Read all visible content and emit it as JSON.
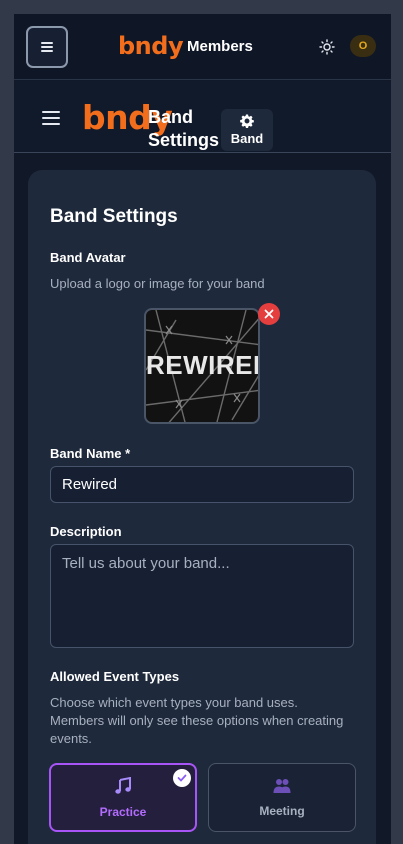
{
  "topbar": {
    "logo": "bndy",
    "title": "Members",
    "theme_icon": "sun-icon",
    "user_initial": "O"
  },
  "header": {
    "logo": "bndy",
    "title": "Band Settings",
    "chip_label": "Band",
    "chip_icon": "gear-icon"
  },
  "card": {
    "title": "Band Settings",
    "avatar": {
      "label": "Band Avatar",
      "help": "Upload a logo or image for your band",
      "image_text": "REWIRED"
    },
    "name": {
      "label": "Band Name *",
      "value": "Rewired"
    },
    "description": {
      "label": "Description",
      "placeholder": "Tell us about your band..."
    },
    "event_types": {
      "label": "Allowed Event Types",
      "help": "Choose which event types your band uses. Members will only see these options when creating events.",
      "options": [
        {
          "label": "Practice",
          "icon": "music-note-icon",
          "selected": true
        },
        {
          "label": "Meeting",
          "icon": "people-icon",
          "selected": false
        }
      ]
    }
  },
  "colors": {
    "brand": "#f26d1c",
    "accent": "#a855f7",
    "danger": "#e53e3e"
  }
}
